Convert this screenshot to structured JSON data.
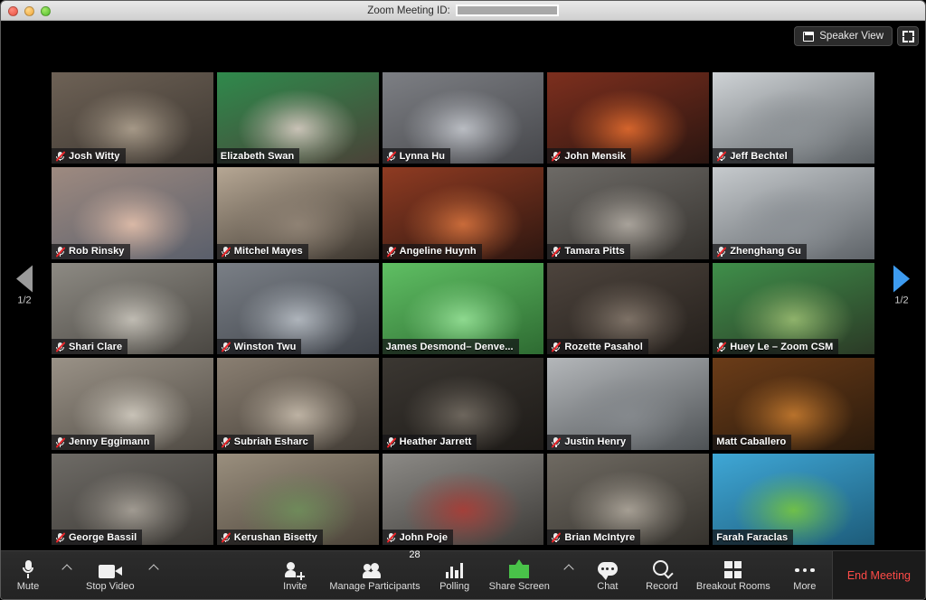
{
  "window": {
    "title_prefix": "Zoom Meeting ID:",
    "meeting_id_redacted": true,
    "traffic_lights": [
      "close-button",
      "minimize-button",
      "zoom-button"
    ]
  },
  "topbar": {
    "view_button_label": "Speaker View",
    "view_button_icon": "layout-grid-icon",
    "fullscreen_icon": "expand-icon"
  },
  "pager": {
    "prev_label": "1/2",
    "next_label": "1/2",
    "prev_icon": "triangle-left-icon",
    "next_icon": "triangle-right-icon",
    "prev_color": "#9a9a9a",
    "next_color": "#3d9bf0"
  },
  "gallery": {
    "active_speaker_color": "#c8e04a",
    "participants": [
      {
        "name": "Josh Witty",
        "muted": true,
        "active": false,
        "bg": "office-desk-man",
        "c1": "#6e6256",
        "c2": "#a59887",
        "c3": "#3c3630"
      },
      {
        "name": "Elizabeth Swan",
        "muted": false,
        "active": false,
        "bg": "office-green-wall-woman",
        "c1": "#2f8a4c",
        "c2": "#c9c2b6",
        "c3": "#4a4238"
      },
      {
        "name": "Lynna Hu",
        "muted": true,
        "active": false,
        "bg": "office-ceiling-woman",
        "c1": "#7d7f84",
        "c2": "#b9bcc2",
        "c3": "#46474b"
      },
      {
        "name": "John Mensik",
        "muted": true,
        "active": false,
        "bg": "sunset-virtual-bg-man",
        "c1": "#7d2f1e",
        "c2": "#d4642c",
        "c3": "#2a1510"
      },
      {
        "name": "Jeff Bechtel",
        "muted": true,
        "active": false,
        "bg": "office-bright-man",
        "c1": "#cfd3d6",
        "c2": "#8d9296",
        "c3": "#5a5f63"
      },
      {
        "name": "Rob Rinsky",
        "muted": true,
        "active": false,
        "bg": "baby-closeup",
        "c1": "#9e8a80",
        "c2": "#d9b8a6",
        "c3": "#5a5f6b"
      },
      {
        "name": "Mitchel Mayes",
        "muted": true,
        "active": false,
        "bg": "office-cubicle-man",
        "c1": "#b6a794",
        "c2": "#8f8274",
        "c3": "#3b352e"
      },
      {
        "name": "Angeline Huynh",
        "muted": true,
        "active": false,
        "bg": "mars-virtual-bg-woman",
        "c1": "#8f3b22",
        "c2": "#c96b3a",
        "c3": "#2d1610"
      },
      {
        "name": "Tamara Pitts",
        "muted": true,
        "active": false,
        "bg": "office-woman-smiling",
        "c1": "#6d6a66",
        "c2": "#a8a29a",
        "c3": "#36332f"
      },
      {
        "name": "Zhenghang Gu",
        "muted": true,
        "active": false,
        "bg": "office-whiteboard-man",
        "c1": "#c6cacd",
        "c2": "#8b9095",
        "c3": "#5f6469"
      },
      {
        "name": "Shari Clare",
        "muted": true,
        "active": false,
        "bg": "office-woman-desk",
        "c1": "#8d8a83",
        "c2": "#bfbbb2",
        "c3": "#4a4742"
      },
      {
        "name": "Winston Twu",
        "muted": true,
        "active": false,
        "bg": "train-interior-man",
        "c1": "#7a7f86",
        "c2": "#aeb4bb",
        "c3": "#3f434a"
      },
      {
        "name": "James Desmond– Denve...",
        "muted": false,
        "active": false,
        "bg": "green-screen-man",
        "c1": "#5fbf63",
        "c2": "#8ed98f",
        "c3": "#2e6b32"
      },
      {
        "name": "Rozette Pasahol",
        "muted": true,
        "active": false,
        "bg": "office-dark-woman",
        "c1": "#4d443d",
        "c2": "#7d7166",
        "c3": "#241f1b"
      },
      {
        "name": "Huey Le – Zoom CSM",
        "muted": true,
        "active": false,
        "bg": "office-green-chair-man",
        "c1": "#3f8f4a",
        "c2": "#8fb26b",
        "c3": "#2b3a26"
      },
      {
        "name": "Jenny Eggimann",
        "muted": true,
        "active": false,
        "bg": "office-woman-long-hair",
        "c1": "#9a9287",
        "c2": "#c8c2b7",
        "c3": "#4f4a43"
      },
      {
        "name": "Subriah Esharc",
        "muted": true,
        "active": false,
        "bg": "office-woman-smiling-2",
        "c1": "#8a7f72",
        "c2": "#bdb2a3",
        "c3": "#423c35"
      },
      {
        "name": "Heather Jarrett",
        "muted": true,
        "active": false,
        "bg": "office-dark-woman-2",
        "c1": "#3b3732",
        "c2": "#6d665d",
        "c3": "#1d1a17"
      },
      {
        "name": "Justin Henry",
        "muted": true,
        "active": false,
        "bg": "office-man-window",
        "c1": "#b4b7ba",
        "c2": "#85898d",
        "c3": "#4e5255"
      },
      {
        "name": "Matt Caballero",
        "muted": false,
        "active": false,
        "bg": "forest-virtual-bg-man",
        "c1": "#6b3c18",
        "c2": "#b8722c",
        "c3": "#2a1a0c"
      },
      {
        "name": "George Bassil",
        "muted": true,
        "active": false,
        "bg": "office-man-blue-shirt",
        "c1": "#6e6b66",
        "c2": "#a09a91",
        "c3": "#3a3733"
      },
      {
        "name": "Kerushan Bisetty",
        "muted": true,
        "active": false,
        "bg": "backyard-fence",
        "c1": "#9a8f7e",
        "c2": "#6f8a5a",
        "c3": "#4a4238"
      },
      {
        "name": "John Poje",
        "muted": true,
        "active": false,
        "bg": "office-man-red-jacket",
        "c1": "#8c8a86",
        "c2": "#a3403a",
        "c3": "#3d3b38"
      },
      {
        "name": "Brian McIntyre",
        "muted": true,
        "active": false,
        "bg": "office-two-people",
        "c1": "#6f6a62",
        "c2": "#a59e93",
        "c3": "#35322d"
      },
      {
        "name": "Farah Faraclas",
        "muted": false,
        "active": true,
        "bg": "lake-mountains-virtual-bg-woman",
        "c1": "#3fa7d6",
        "c2": "#6fbf4a",
        "c3": "#1d5c7a"
      }
    ]
  },
  "toolbar": {
    "left": [
      {
        "label": "Mute",
        "icon": "microphone-icon",
        "has_caret": true,
        "badge": null
      },
      {
        "label": "Stop Video",
        "icon": "camera-icon",
        "has_caret": true,
        "badge": null
      }
    ],
    "center": [
      {
        "label": "Invite",
        "icon": "invite-person-icon",
        "has_caret": false,
        "badge": null
      },
      {
        "label": "Manage Participants",
        "icon": "participants-icon",
        "has_caret": false,
        "badge": "28"
      },
      {
        "label": "Polling",
        "icon": "bar-chart-icon",
        "has_caret": false,
        "badge": null
      },
      {
        "label": "Share Screen",
        "icon": "share-screen-icon",
        "has_caret": true,
        "badge": null
      },
      {
        "label": "Chat",
        "icon": "chat-bubble-icon",
        "has_caret": false,
        "badge": null
      },
      {
        "label": "Record",
        "icon": "record-icon",
        "has_caret": false,
        "badge": null
      },
      {
        "label": "Breakout Rooms",
        "icon": "breakout-rooms-icon",
        "has_caret": false,
        "badge": null
      },
      {
        "label": "More",
        "icon": "more-dots-icon",
        "has_caret": false,
        "badge": null
      }
    ],
    "end_meeting_label": "End Meeting",
    "end_meeting_color": "#ff4b47",
    "share_screen_color": "#49c249"
  }
}
